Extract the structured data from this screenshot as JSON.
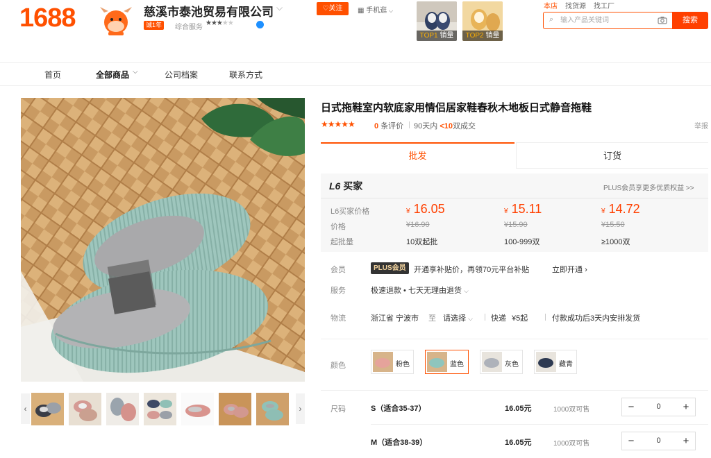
{
  "header": {
    "logo": "1688",
    "shop_name": "慈溪市泰池贸易有限公司",
    "years_badge": "诚1年",
    "service_label": "综合服务",
    "follow_label": "关注",
    "mobile_label": "手机逛",
    "top_products": [
      {
        "rank": "TOP1",
        "label": "销量"
      },
      {
        "rank": "TOP2",
        "label": "销量"
      }
    ],
    "search_tabs": [
      "本店",
      "找货源",
      "找工厂"
    ],
    "search_placeholder": "输入产品关键词",
    "search_button": "搜索"
  },
  "nav": {
    "items": [
      "首页",
      "全部商品",
      "公司档案",
      "联系方式"
    ]
  },
  "product": {
    "title": "日式拖鞋室内软底家用情侣居家鞋春秋木地板日式静音拖鞋",
    "stars": "★★★★★",
    "review_count": "0",
    "review_suffix": "条评价",
    "deal_prefix": "90天内",
    "deal_count": "<10",
    "deal_suffix": "双成交",
    "report": "举报"
  },
  "tabs": {
    "wholesale": "批发",
    "order": "订货"
  },
  "pricing": {
    "tier_title_l6": "L6",
    "tier_title": "买家",
    "plus_link": "PLUS会员享更多优质权益 >>",
    "row_labels": [
      "L6买家价格",
      "价格",
      "起批量"
    ],
    "currency": "¥",
    "tiers": [
      {
        "price": "16.05",
        "old": "¥16.90",
        "moq": "10双起批"
      },
      {
        "price": "15.11",
        "old": "¥15.90",
        "moq": "100-999双"
      },
      {
        "price": "14.72",
        "old": "¥15.50",
        "moq": "≥1000双"
      }
    ]
  },
  "member": {
    "label": "会员",
    "badge": "PLUS会员",
    "text": "开通享补贴价，再领70元平台补贴",
    "link": "立即开通"
  },
  "service": {
    "label": "服务",
    "text": "极速退款 • 七天无理由退货"
  },
  "logistics": {
    "label": "物流",
    "origin": "浙江省 宁波市",
    "to": "至",
    "select": "请选择",
    "express": "快递",
    "fee": "¥5起",
    "ship": "付款成功后3天内安排发货"
  },
  "colors": {
    "label": "颜色",
    "options": [
      "粉色",
      "蓝色",
      "灰色",
      "藏青"
    ],
    "selected": "蓝色",
    "swatch_colors": [
      "#e8a9a0",
      "#8fc5bd",
      "#b8bcc4",
      "#2e3a52"
    ]
  },
  "sizes": {
    "label": "尺码",
    "rows": [
      {
        "name": "S（适合35-37）",
        "price": "16.05元",
        "stock": "1000双可售",
        "qty": "0"
      },
      {
        "name": "M（适合38-39）",
        "price": "16.05元",
        "stock": "1000双可售",
        "qty": "0"
      }
    ]
  }
}
